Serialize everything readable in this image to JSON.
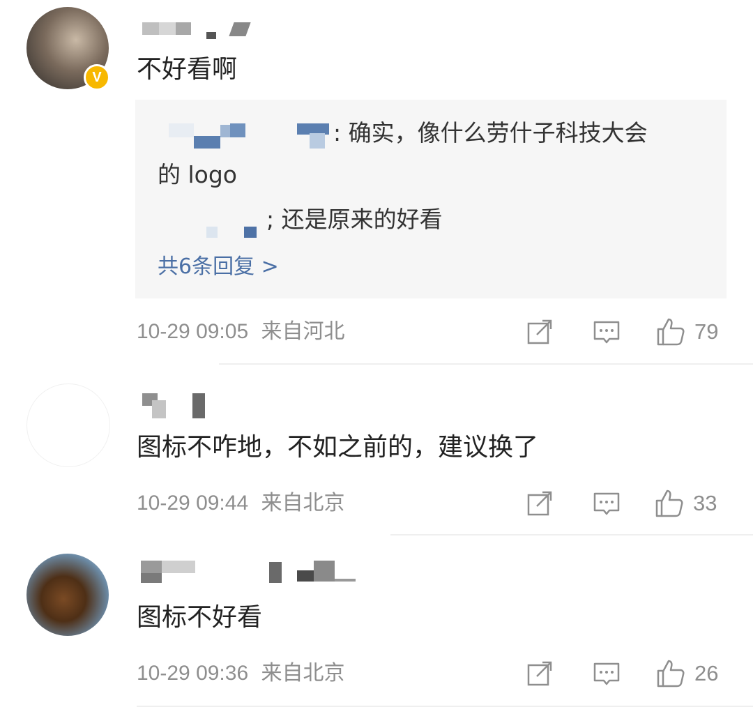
{
  "comments": [
    {
      "content": "不好看啊",
      "replies": [
        {
          "text": ": 确实，像什么劳什子科技大会"
        },
        {
          "text": "的 logo"
        },
        {
          "text": "; 还是原来的好看"
        }
      ],
      "more_replies": "共6条回复 >",
      "timestamp": "10-29 09:05",
      "location": "来自河北",
      "likes": "79"
    },
    {
      "content": "图标不咋地，不如之前的，建议换了",
      "timestamp": "10-29 09:44",
      "location": "来自北京",
      "likes": "33"
    },
    {
      "content": "图标不好看",
      "timestamp": "10-29 09:36",
      "location": "来自北京",
      "likes": "26"
    }
  ],
  "icons": {
    "share": "share-icon",
    "comment": "comment-icon",
    "like": "thumbs-up-icon",
    "verified": "verified-badge-icon"
  },
  "colors": {
    "link": "#4a6fa5",
    "verified_badge": "#f7b800",
    "meta_text": "#8e8e8e",
    "reply_bg": "#f6f6f6"
  }
}
